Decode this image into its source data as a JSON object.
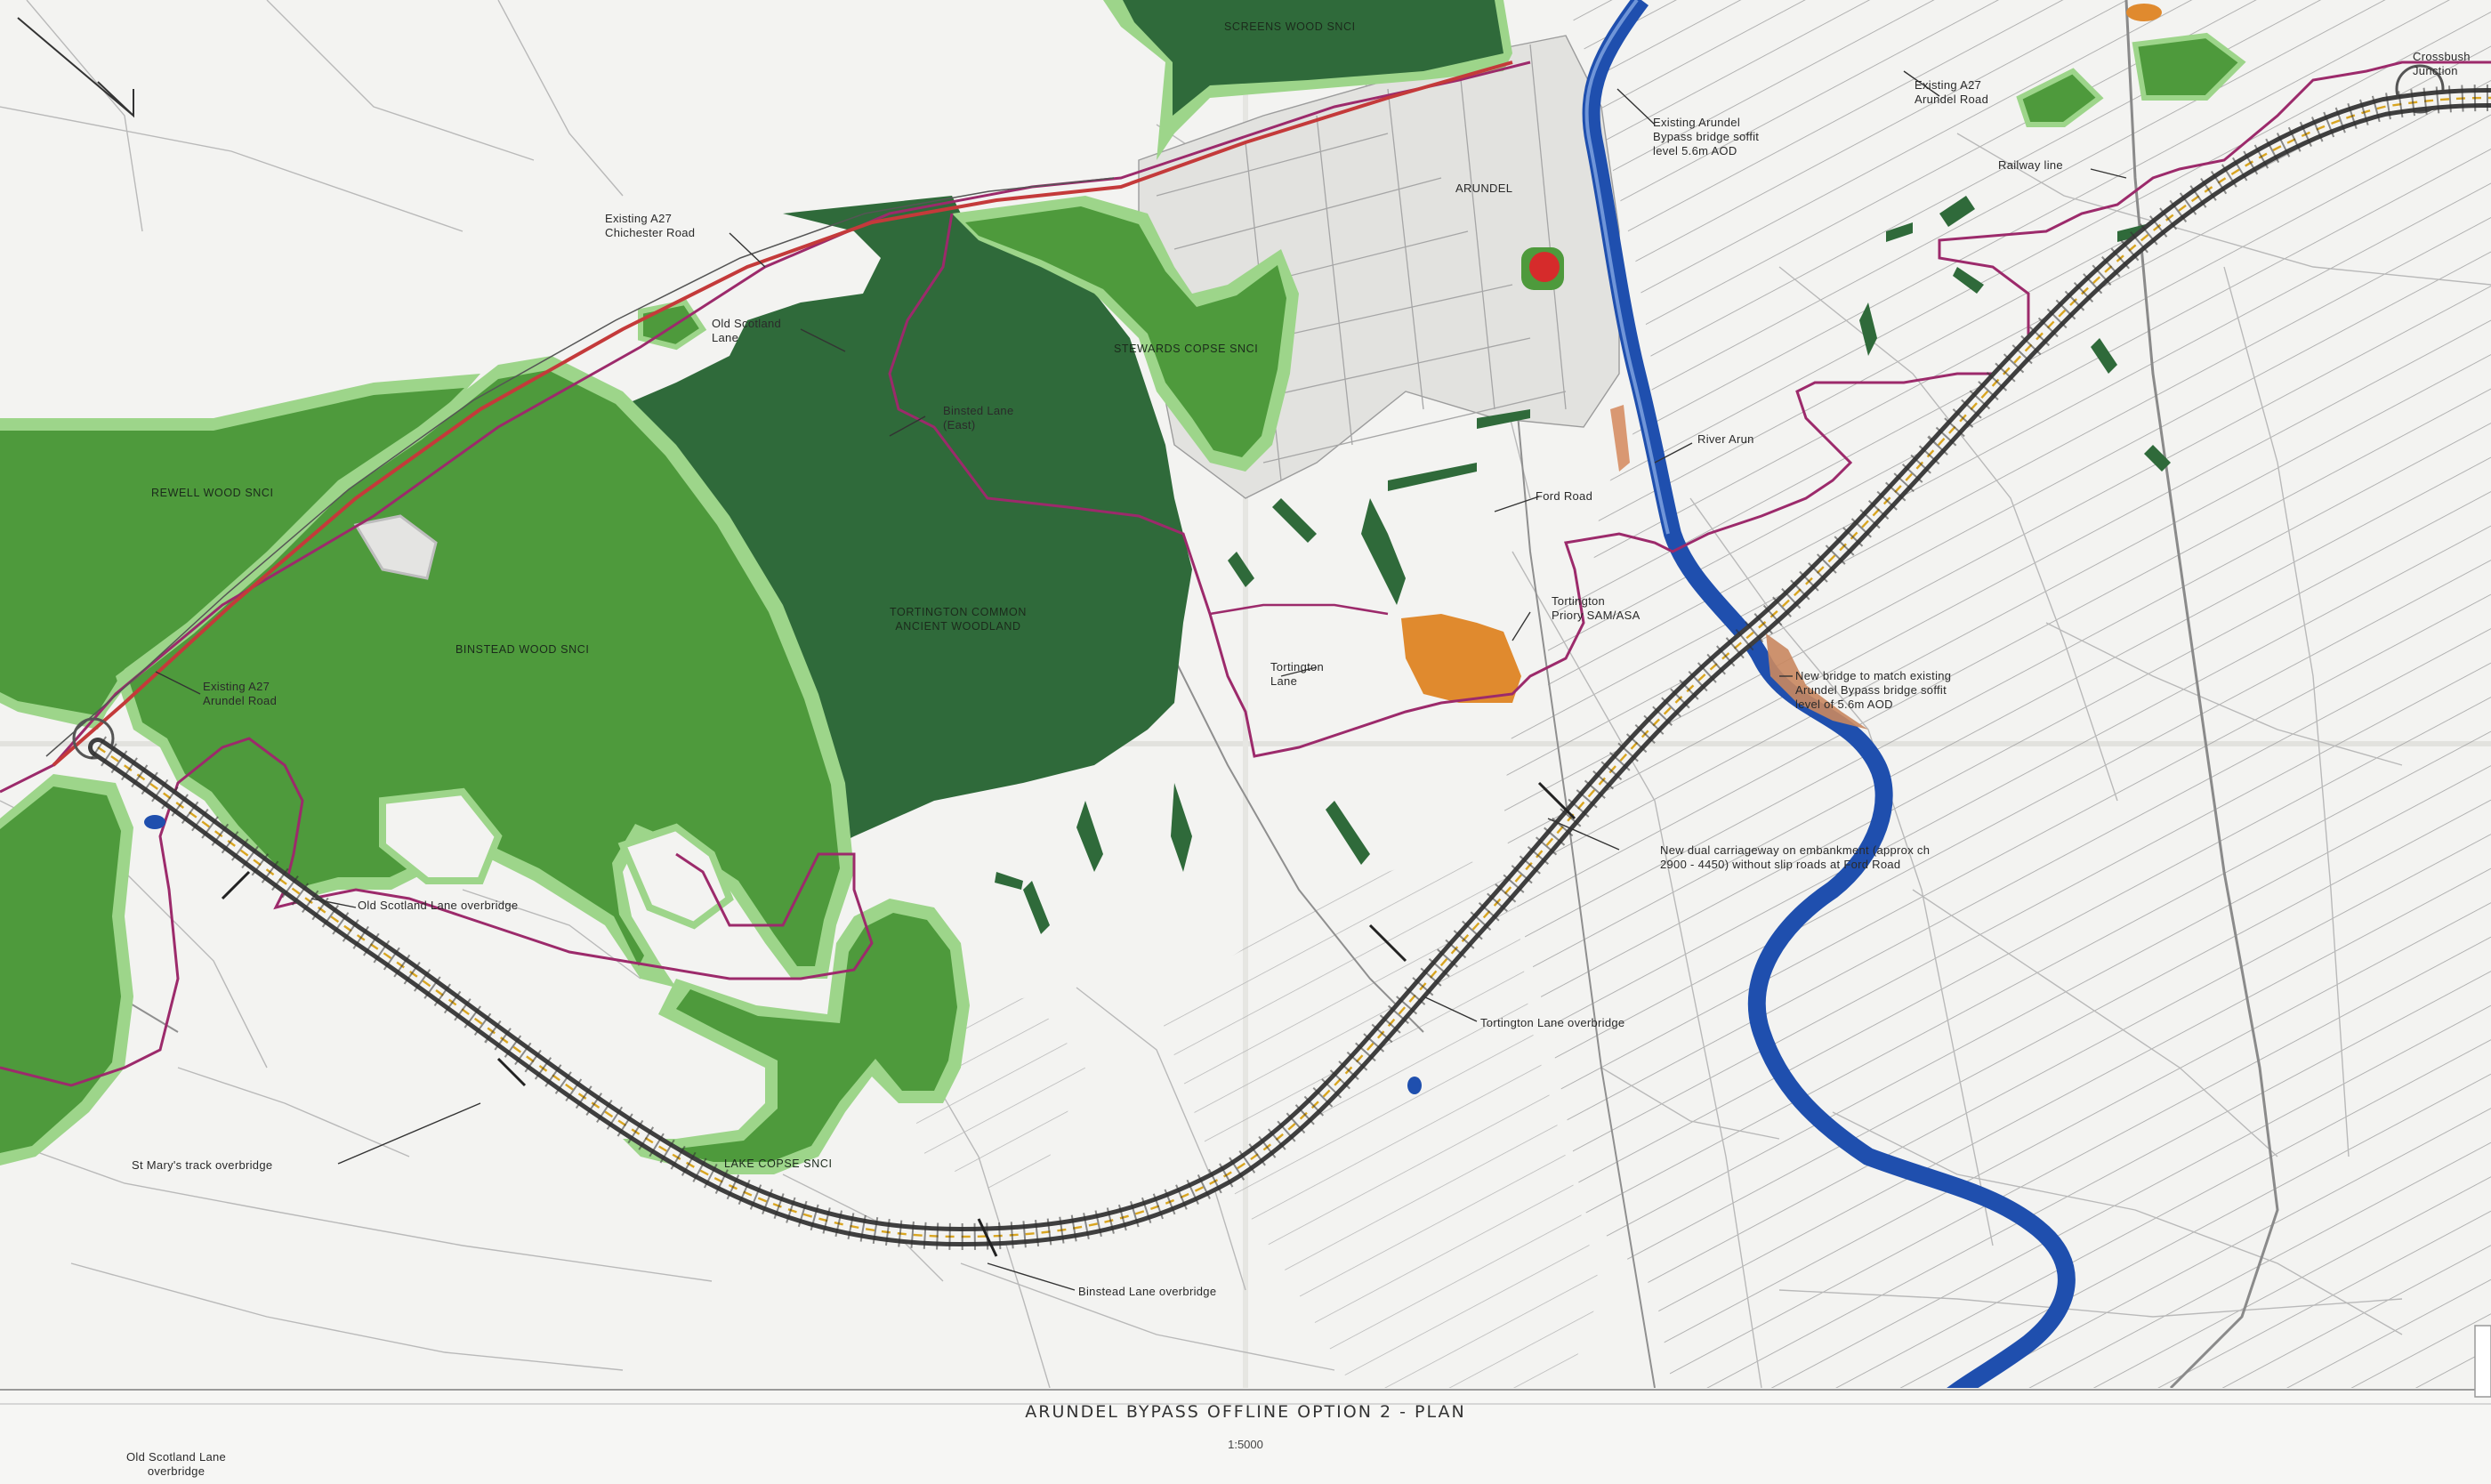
{
  "map": {
    "title": "ARUNDEL BYPASS OFFLINE OPTION 2 - PLAN",
    "scale": "1:5000",
    "colors": {
      "paper": "#f3f3f1",
      "ancient_woodland": "#2f6a3a",
      "snci_woodland": "#4e9a3c",
      "snci_border": "#9dd58a",
      "river": "#2a5bb8",
      "boundary": "#9c2a6b",
      "road_casing": "#444444",
      "heritage": "#e08a2e",
      "marker": "#d62b2b",
      "hatch": "#9a9a9a"
    },
    "areas": {
      "screens_wood": "SCREENS WOOD SNCI",
      "rewell_wood": "REWELL WOOD SNCI",
      "binstead_wood": "BINSTEAD WOOD SNCI",
      "tortington_common": "TORTINGTON COMMON\nANCIENT WOODLAND",
      "stewards_copse": "STEWARDS COPSE SNCI",
      "lake_copse": "LAKE COPSE SNCI"
    },
    "annotations": {
      "existing_a27_chichester": "Existing A27\nChichester Road",
      "old_scotland_lane": "Old Scotland\nLane",
      "binsted_lane_east": "Binsted Lane\n(East)",
      "arundel": "ARUNDEL",
      "existing_arundel_bypass": "Existing Arundel\nBypass bridge soffit\nlevel 5.6m AOD",
      "existing_a27_arundel_road_ne": "Existing A27\nArundel Road",
      "railway_line": "Railway line",
      "crossbush_junction": "Crossbush\nJunction",
      "river_arun": "River Arun",
      "ford_road": "Ford Road",
      "tortington_priory": "Tortington\nPriory SAM/ASA",
      "tortington_lane": "Tortington\nLane",
      "new_bridge": "New bridge to match existing\nArundel Bypass bridge soffit\nlevel of 5.6m AOD",
      "existing_a27_arundel_road_w": "Existing A27\nArundel Road",
      "new_dual_carriageway": "New dual carriageway on embankment (approx ch\n2900 - 4450) without slip roads at Ford Road",
      "old_scotland_lane_overbridge": "Old Scotland Lane overbridge",
      "tortington_lane_overbridge": "Tortington Lane overbridge",
      "st_marys_track": "St Mary's track overbridge",
      "binstead_lane_overbridge": "Binstead Lane overbridge",
      "off_sheet_overbridge": "Old Scotland Lane\noverbridge"
    }
  }
}
